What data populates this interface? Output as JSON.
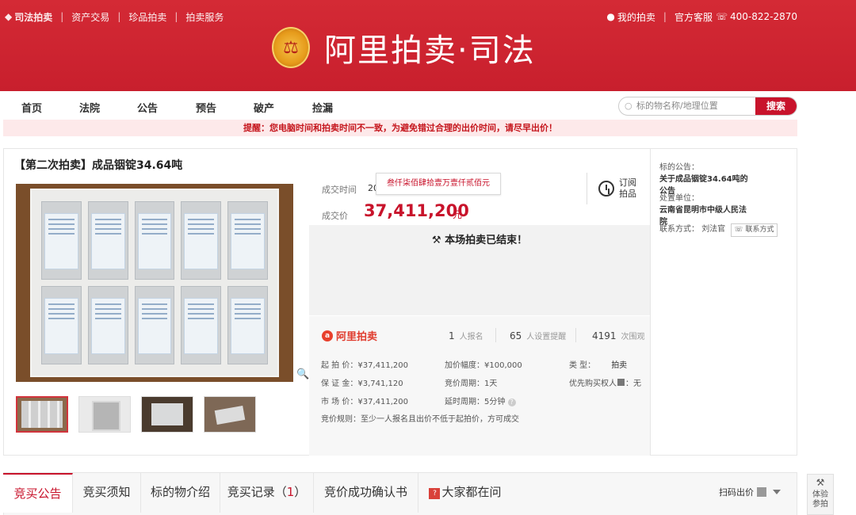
{
  "header": {
    "brand": "司法拍卖",
    "links": [
      "资产交易",
      "珍品拍卖",
      "拍卖服务"
    ],
    "my_auction": "我的拍卖",
    "service": "官方客服",
    "phone": "400-822-2870",
    "logo_text": "阿里拍卖·司法",
    "emblem_glyph": "⚖"
  },
  "nav": {
    "items": [
      "首页",
      "法院",
      "公告",
      "预告",
      "破产",
      "捡漏"
    ],
    "search_placeholder": "标的物名称/地理位置",
    "search_button": "搜索"
  },
  "warning": "提醒：您电脑时间和拍卖时间不一致，为避免错过合理的出价时间，请尽早出价！",
  "lot": {
    "title": "【第二次拍卖】成品铟锭34.64吨",
    "deal_time_label": "成交时间",
    "deal_time_value": "20",
    "deal_price_label": "成交价",
    "deal_price": "37,411,200",
    "price_unit": "元",
    "tooltip": "叁仟柒佰肆拾壹万壹仟贰佰元",
    "subscribe": "订阅拍品",
    "ended": "本场拍卖已结束！"
  },
  "stats": {
    "brand": "阿里拍卖",
    "signup_count": "1",
    "signup_label": "人报名",
    "reminder_count": "65",
    "reminder_label": "人设置提醒",
    "view_count": "4191",
    "view_label": "次围观",
    "rows": {
      "start_price": "起 拍 价：¥37,411,200",
      "increment": "加价幅度：¥100,000",
      "type_label": "类 型：",
      "type_value": "拍卖",
      "deposit": "保 证 金：¥3,741,120",
      "period": "竞价周期：1天",
      "priority": "优先购买权人",
      "priority_value": "：无",
      "market_price": "市 场 价：¥37,411,200",
      "delay": "延时周期：5分钟",
      "rule": "竞价规则：至少一人报名且出价不低于起拍价，方可成交"
    }
  },
  "side": {
    "notice_label": "标的公告：",
    "notice_value": "关于成品铟锭34.64吨的公告",
    "unit_label": "处置单位：",
    "unit_value": "云南省昆明市中级人民法院",
    "contact_label": "联系方式：",
    "contact_name": "刘法官",
    "contact_button": "联系方式"
  },
  "tabs": {
    "items": [
      "竞买公告",
      "竞买须知",
      "标的物介绍",
      "竞买记录（",
      "竞价成功确认书",
      "大家都在问"
    ],
    "record_count": "1",
    "record_close": "）",
    "qr_label": "扫码出价"
  },
  "float": {
    "label": "体验参拍"
  },
  "colors": {
    "brand_red": "#c8132b",
    "header_red": "#d42a35"
  }
}
